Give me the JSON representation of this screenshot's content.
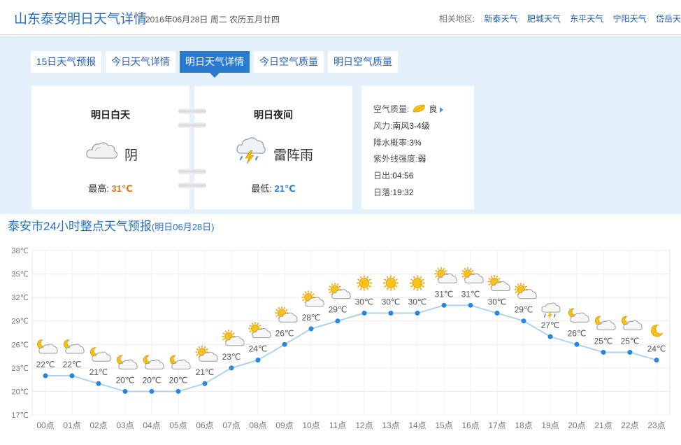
{
  "header": {
    "title": "山东泰安明日天气详情",
    "date": "2016年06月28日 周二 农历五月廿四",
    "related_label": "相关地区:",
    "related": [
      "新泰天气",
      "肥城天气",
      "东平天气",
      "宁阳天气",
      "岱岳天"
    ]
  },
  "tabs": [
    {
      "label": "15日天气预报",
      "active": false
    },
    {
      "label": "今日天气详情",
      "active": false
    },
    {
      "label": "明日天气详情",
      "active": true
    },
    {
      "label": "今日空气质量",
      "active": false
    },
    {
      "label": "明日空气质量",
      "active": false
    }
  ],
  "day": {
    "title": "明日白天",
    "weather": "阴",
    "icon": "overcast-icon",
    "temp_label": "最高:",
    "temp": "31℃"
  },
  "night": {
    "title": "明日夜间",
    "weather": "雷阵雨",
    "icon": "thunderstorm-icon",
    "temp_label": "最低:",
    "temp": "21℃"
  },
  "info": {
    "aq_label": "空气质量:",
    "aq_value": "良",
    "wind_label": "风力:",
    "wind_value": "南风3-4级",
    "rain_label": "降水概率:",
    "rain_value": "3%",
    "uv_label": "紫外线强度:",
    "uv_value": "弱",
    "sunrise_label": "日出:",
    "sunrise_value": "04:56",
    "sunset_label": "日落:",
    "sunset_value": "19:32"
  },
  "chart_title": {
    "main": "泰安市24小时整点天气预报",
    "sub": "(明日06月28日)"
  },
  "colors": {
    "accent": "#2b7ad2",
    "line": "#aed3f2",
    "dot": "#2a86db",
    "panel": "#e4f0fc"
  },
  "chart_data": {
    "type": "line",
    "x": [
      "00点",
      "01点",
      "02点",
      "03点",
      "04点",
      "05点",
      "06点",
      "07点",
      "08点",
      "09点",
      "10点",
      "11点",
      "12点",
      "13点",
      "14点",
      "15点",
      "16点",
      "17点",
      "18点",
      "19点",
      "20点",
      "21点",
      "22点",
      "23点"
    ],
    "series": [
      {
        "values": [
          22,
          22,
          21,
          20,
          20,
          20,
          21,
          23,
          24,
          26,
          28,
          29,
          30,
          30,
          30,
          31,
          31,
          30,
          29,
          27,
          26,
          25,
          25,
          24
        ]
      }
    ],
    "point_labels": [
      "22℃",
      "22℃",
      "21℃",
      "20℃",
      "20℃",
      "20℃",
      "21℃",
      "23℃",
      "24℃",
      "26℃",
      "28℃",
      "29℃",
      "30℃",
      "30℃",
      "30℃",
      "31℃",
      "31℃",
      "30℃",
      "29℃",
      "27℃",
      "26℃",
      "25℃",
      "25℃",
      "24℃"
    ],
    "icons": [
      "moon-cloud",
      "moon-cloud",
      "moon-cloud",
      "moon-cloud",
      "moon-cloud",
      "moon-cloud",
      "sun-cloud",
      "sun-cloud",
      "sun-cloud",
      "sun-cloud",
      "sun-cloud",
      "sun-cloud",
      "sun",
      "sun",
      "sun",
      "sun-cloud",
      "sun-cloud",
      "sun-cloud",
      "sun-cloud",
      "thunder",
      "moon-cloud",
      "moon-cloud",
      "moon-cloud",
      "moon"
    ],
    "y_ticks": [
      "17℃",
      "20℃",
      "23℃",
      "26℃",
      "29℃",
      "32℃",
      "35℃",
      "38℃"
    ],
    "ylim": [
      17,
      38
    ],
    "grid": true
  }
}
